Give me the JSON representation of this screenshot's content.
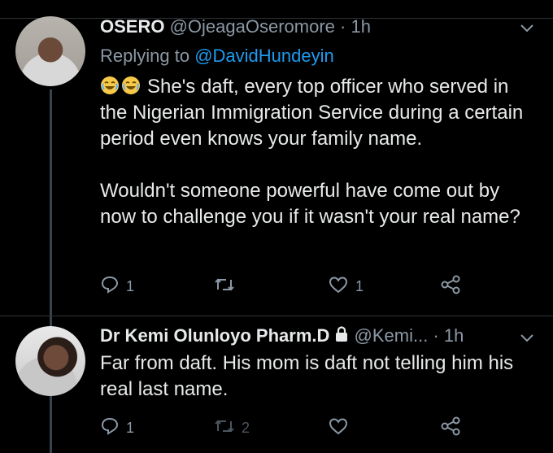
{
  "tweets": [
    {
      "name": "OSERO",
      "handle": "@OjeagaOseromore",
      "time": "1h",
      "replying_prefix": "Replying to",
      "replying_to": "@DavidHundeyin",
      "text": [
        "She's daft, every top officer who served in the Nigerian Immigration Service during a certain period even knows your family name.",
        "Wouldn't someone powerful have come out by now to challenge you if it wasn't your real name?"
      ],
      "actions": {
        "replies": "1",
        "retweets": "",
        "likes": "1"
      }
    },
    {
      "name": "Dr Kemi Olunloyo Pharm.D",
      "handle": "@Kemi...",
      "time": "1h",
      "text": [
        "Far from daft. His mom is daft not telling him his real last name."
      ],
      "actions": {
        "replies": "1",
        "retweets": "2",
        "likes": ""
      }
    }
  ],
  "icons": {
    "reply": "reply-icon",
    "retweet": "retweet-icon",
    "like": "like-icon",
    "share": "share-icon",
    "more": "chevron-down-icon",
    "lock": "lock-icon",
    "emoji": "joy-emoji"
  },
  "colors": {
    "background": "#000000",
    "text": "#e7e9ea",
    "muted": "#8b98a5",
    "link": "#1d9bf0",
    "divider": "#2f3336"
  },
  "separator": "·"
}
